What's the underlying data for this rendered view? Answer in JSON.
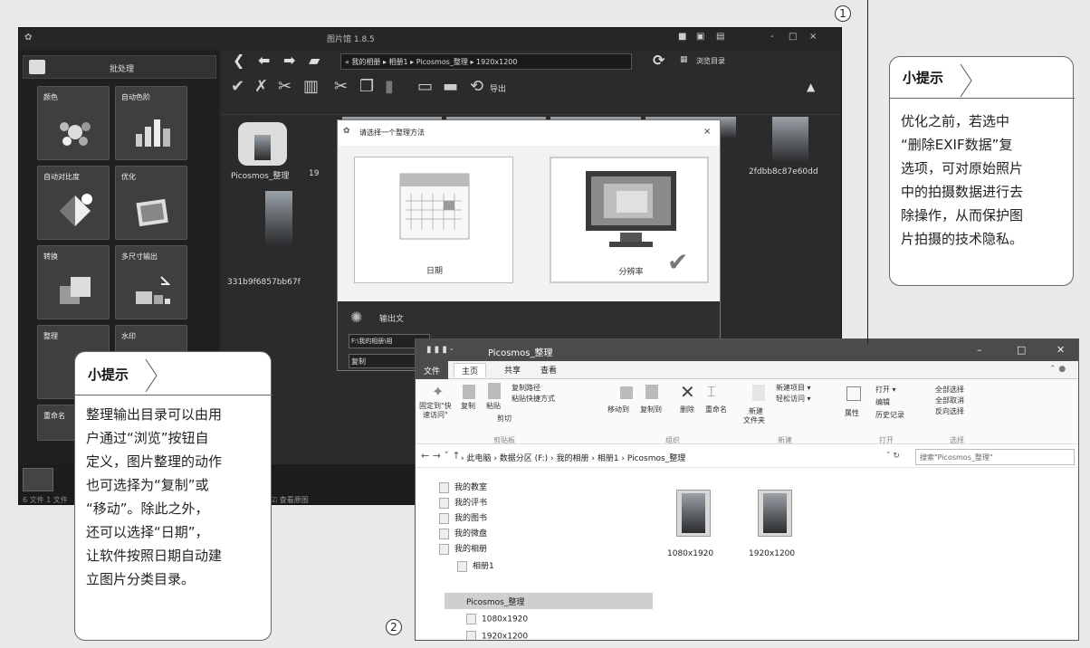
{
  "app": {
    "title": "图片馆 1.8.5",
    "batch_label": "批处理",
    "tiles": [
      {
        "label": "颜色"
      },
      {
        "label": "自动色阶"
      },
      {
        "label": "自动对比度"
      },
      {
        "label": "优化"
      },
      {
        "label": "转换"
      },
      {
        "label": "多尺寸输出"
      },
      {
        "label": "整理"
      },
      {
        "label": "水印"
      },
      {
        "label": "重命名"
      }
    ],
    "address": "« 我的相册 ▸ 相册1 ▸ Picosmos_整理 ▸ 1920x1200",
    "browse_label": "浏览目录",
    "export_label": "导出",
    "thumbs": [
      "Picosmos_整理",
      "19",
      "2fdbb8c87e60dd",
      "331b9f6857bb67f"
    ],
    "status_text": "6 文件  1 文件",
    "status_check": "☑ 查看原图"
  },
  "dialog": {
    "title": "请选择一个整理方法",
    "close": "×",
    "option_date": "日期",
    "option_resolution": "分辨率",
    "output_label": "输出文",
    "path_value": "F:\\我的相册\\相",
    "action_value": "复制"
  },
  "explorer": {
    "title": "Picosmos_整理",
    "tabs": {
      "file": "文件",
      "home": "主页",
      "share": "共享",
      "view": "查看"
    },
    "ribbon": {
      "pin": "固定到\"快\n速访问\"",
      "pin1": "固定到\"快",
      "pin2": "速访问\"",
      "copy": "复制",
      "paste": "粘贴",
      "copy_path": "复制路径",
      "paste_shortcut": "粘贴快捷方式",
      "cut": "剪切",
      "move_to": "移动到",
      "copy_to": "复制到",
      "delete": "删除",
      "rename": "重命名",
      "new_folder1": "新建",
      "new_folder2": "文件夹",
      "new_item": "新建项目 ▾",
      "easy_access": "轻松访问 ▾",
      "properties": "属性",
      "open": "打开 ▾",
      "edit": "编辑",
      "history": "历史记录",
      "select_all": "全部选择",
      "select_none": "全部取消",
      "invert": "反向选择",
      "grp_clipboard": "剪贴板",
      "grp_organize": "组织",
      "grp_new": "新建",
      "grp_open": "打开",
      "grp_select": "选择"
    },
    "breadcrumb": "› 此电脑 › 数据分区 (F:) › 我的相册 › 相册1 › Picosmos_整理",
    "search_placeholder": "搜索\"Picosmos_整理\"",
    "nav_items": [
      "我的教室",
      "我的评书",
      "我的图书",
      "我的微盘",
      "我的相册",
      "相册1",
      "Picosmos_整理",
      "1080x1920",
      "1920x1200"
    ],
    "files": [
      "1080x1920",
      "1920x1200"
    ]
  },
  "tips": {
    "tip1_title": "小提示",
    "tip1_lines": [
      "优化之前，若选中",
      "“删除EXIF数据”复",
      "选项，可对原始照片",
      "中的拍摄数据进行去",
      "除操作，从而保护图",
      "片拍摄的技术隐私。"
    ],
    "tip2_title": "小提示",
    "tip2_lines": [
      "整理输出目录可以由用",
      "户通过“浏览”按钮自",
      "定义，图片整理的动作",
      "也可选择为“复制”或",
      "“移动”。除此之外，",
      "还可以选择“日期”，",
      "让软件按照日期自动建",
      "立图片分类目录。"
    ]
  },
  "markers": {
    "one": "1",
    "two": "2"
  }
}
